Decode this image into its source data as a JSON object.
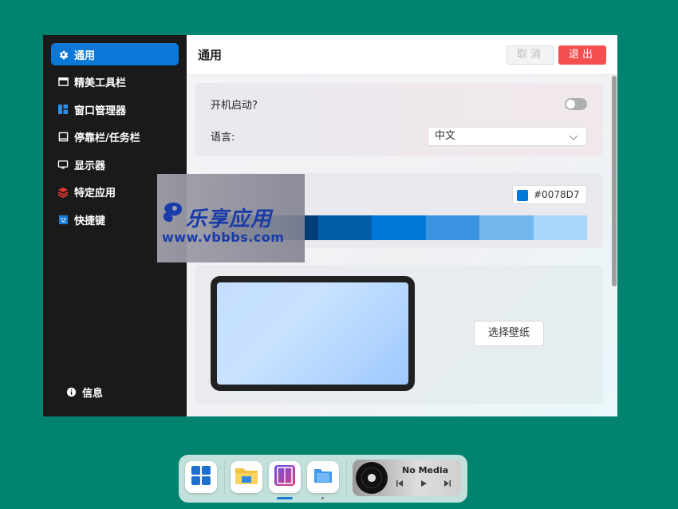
{
  "sidebar": {
    "items": [
      {
        "label": "通用",
        "icon": "gear-icon"
      },
      {
        "label": "精美工具栏",
        "icon": "toolbar-icon"
      },
      {
        "label": "窗口管理器",
        "icon": "window-manager-icon"
      },
      {
        "label": "停靠栏/任务栏",
        "icon": "dock-icon"
      },
      {
        "label": "显示器",
        "icon": "monitor-icon"
      },
      {
        "label": "特定应用",
        "icon": "layers-icon"
      },
      {
        "label": "快捷键",
        "icon": "keyboard-icon"
      }
    ],
    "info_label": "信息",
    "active_color": "#0B78D8"
  },
  "header": {
    "title": "通用",
    "cancel_label": "取消",
    "exit_label": "退出",
    "exit_color": "#F44F4F"
  },
  "general": {
    "startup_label": "开机启动?",
    "startup_enabled": false,
    "language_label": "语言:",
    "language_value": "中文"
  },
  "accent": {
    "hex": "#0078D7",
    "palette": [
      "#022E5A",
      "#013E77",
      "#025CA8",
      "#0078D7",
      "#3B93E2",
      "#74B7EE",
      "#A8D6FC"
    ]
  },
  "wallpaper": {
    "button_label": "选择壁纸"
  },
  "watermark": {
    "title": "乐享应用",
    "url": "www.vbbbs.com"
  },
  "dock": {
    "media_title": "No Media"
  }
}
